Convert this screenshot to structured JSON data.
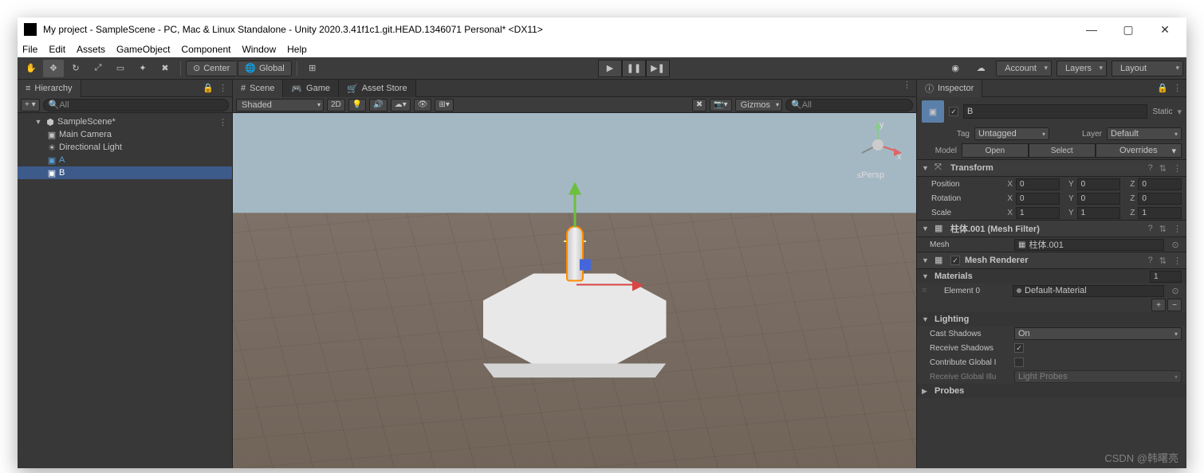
{
  "window": {
    "title": "My project - SampleScene - PC, Mac & Linux Standalone - Unity 2020.3.41f1c1.git.HEAD.1346071 Personal* <DX11>"
  },
  "menu": [
    "File",
    "Edit",
    "Assets",
    "GameObject",
    "Component",
    "Window",
    "Help"
  ],
  "toolbar": {
    "pivot": "Center",
    "space": "Global",
    "account": "Account",
    "layers": "Layers",
    "layout": "Layout"
  },
  "hierarchy": {
    "title": "Hierarchy",
    "searchPlaceholder": "All",
    "scene": "SampleScene*",
    "items": [
      "Main Camera",
      "Directional Light",
      "A",
      "B"
    ],
    "selected": 3
  },
  "sceneTabs": {
    "scene": "Scene",
    "game": "Game",
    "asset": "Asset Store"
  },
  "sceneBar": {
    "shading": "Shaded",
    "mode2d": "2D",
    "gizmos": "Gizmos",
    "searchPlaceholder": "All"
  },
  "viewport": {
    "persp": "Persp"
  },
  "inspector": {
    "title": "Inspector",
    "objectName": "B",
    "static": "Static",
    "tagLabel": "Tag",
    "tag": "Untagged",
    "layerLabel": "Layer",
    "layer": "Default",
    "modelLabel": "Model",
    "openBtn": "Open",
    "selectBtn": "Select",
    "overridesBtn": "Overrides",
    "transform": {
      "title": "Transform",
      "position": {
        "label": "Position",
        "x": "0",
        "y": "0",
        "z": "0"
      },
      "rotation": {
        "label": "Rotation",
        "x": "0",
        "y": "0",
        "z": "0"
      },
      "scale": {
        "label": "Scale",
        "x": "1",
        "y": "1",
        "z": "1"
      }
    },
    "meshFilter": {
      "title": "柱体.001 (Mesh Filter)",
      "meshLabel": "Mesh",
      "meshValue": "柱体.001"
    },
    "meshRenderer": {
      "title": "Mesh Renderer",
      "materials": "Materials",
      "matCount": "1",
      "element0Label": "Element 0",
      "element0Value": "Default-Material",
      "lighting": "Lighting",
      "castShadowsLabel": "Cast Shadows",
      "castShadows": "On",
      "receiveShadowsLabel": "Receive Shadows",
      "contributeGILabel": "Contribute Global I",
      "receiveGILabel": "Receive Global Illu",
      "receiveGI": "Light Probes",
      "probes": "Probes"
    }
  },
  "watermark": "CSDN @韩曙亮"
}
